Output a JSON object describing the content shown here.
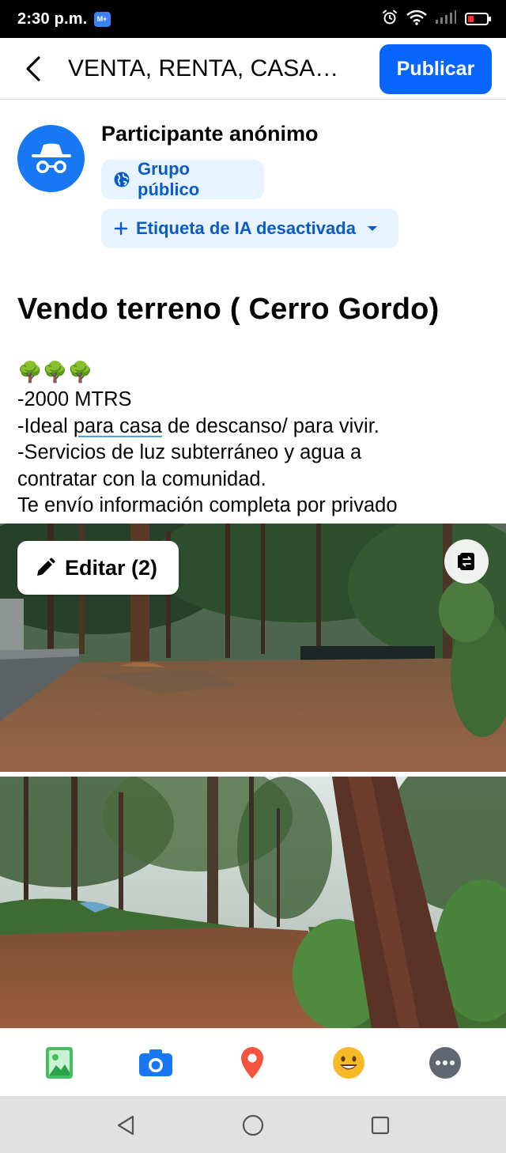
{
  "status_bar": {
    "time": "2:30 p.m.",
    "app_badge": "M+"
  },
  "header": {
    "title": "VENTA, RENTA, CASAS,...",
    "publish_label": "Publicar"
  },
  "author": {
    "name": "Participante anónimo",
    "audience_label": "Grupo público",
    "ai_label": "Etiqueta de IA desactivada"
  },
  "post": {
    "title": "Vendo terreno ( Cerro Gordo)",
    "emoji": "🌳🌳🌳",
    "line_1": "-2000 MTRS",
    "line_2_before": "-Ideal ",
    "line_2_link": "para casa",
    "line_2_after": " de descanso/ para vivir.",
    "line_3": "-Servicios de luz subterráneo y agua a",
    "line_4": "contratar con la comunidad.",
    "line_5": "Te envío información completa por privado"
  },
  "media": {
    "edit_label": "Editar (2)"
  },
  "toolbar": {
    "items": [
      "photo-icon",
      "camera-icon",
      "location-icon",
      "emoji-icon",
      "more-icon"
    ]
  },
  "colors": {
    "brand_blue": "#0866ff",
    "pill_bg": "#e7f3ff",
    "pill_text": "#0a5bc4",
    "avatar_blue": "#1877f2"
  }
}
